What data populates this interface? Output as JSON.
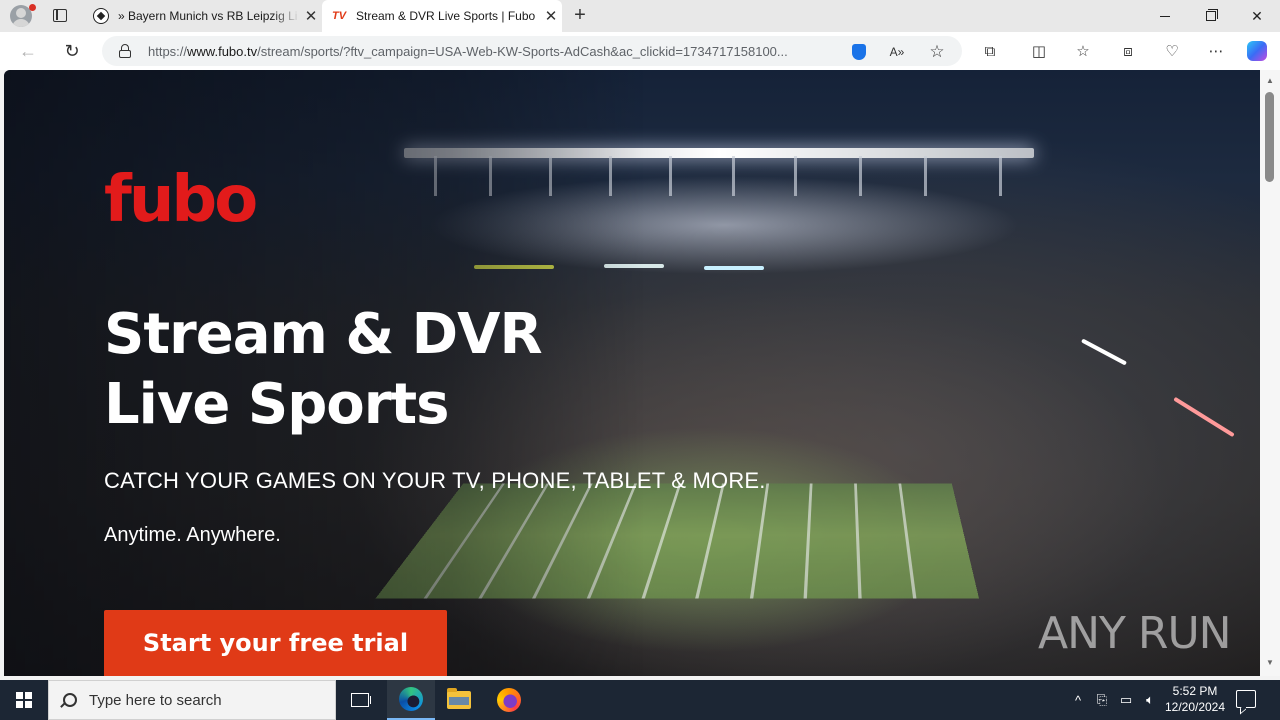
{
  "browser": {
    "tabs": [
      {
        "title": "» Bayern Munich vs RB Leipzig Li",
        "icon": "soccer-ball-icon",
        "active": false
      },
      {
        "title": "Stream & DVR Live Sports | Fubo",
        "icon": "fubo-tv-icon",
        "favicon_text": "TV",
        "active": true
      }
    ],
    "new_tab_label": "+",
    "address": {
      "url_prefix": "https://",
      "url_host": "www.fubo.tv",
      "url_path": "/stream/sports/?ftv_campaign=USA-Web-KW-Sports-AdCash&ac_clickid=1734717158100..."
    }
  },
  "page": {
    "logo": "fubo",
    "headline_line1": "Stream & DVR",
    "headline_line2": "Live Sports",
    "tagline": "CATCH YOUR GAMES ON YOUR TV, PHONE, TABLET & MORE.",
    "subline": "Anytime. Anywhere.",
    "cta_label": "Start your free trial",
    "watermark": "ANY RUN",
    "colors": {
      "brand_red": "#e21b1b",
      "cta_orange": "#e03a17"
    }
  },
  "taskbar": {
    "search_placeholder": "Type here to search",
    "time": "5:52 PM",
    "date": "12/20/2024"
  }
}
